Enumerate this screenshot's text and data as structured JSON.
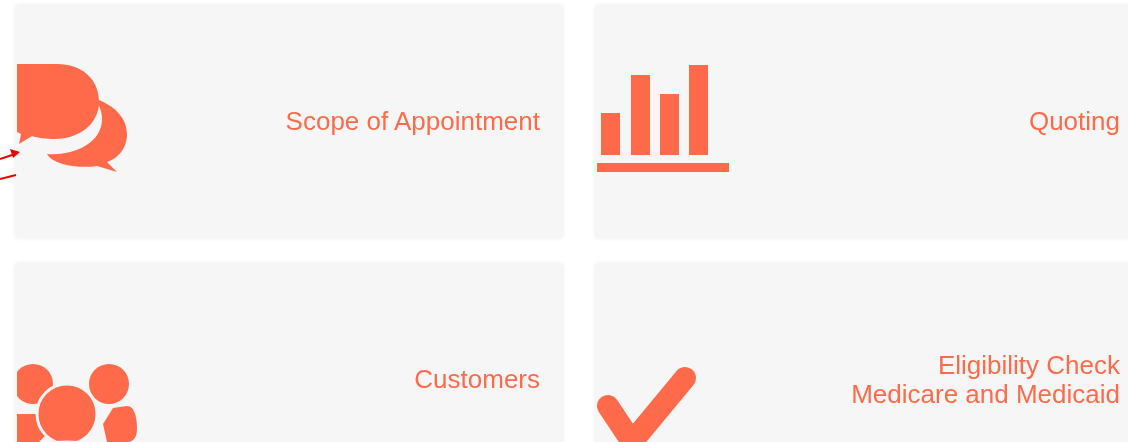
{
  "tiles": [
    {
      "kind": "chat",
      "lines": [
        "Scope of Appointment"
      ]
    },
    {
      "kind": "chart",
      "lines": [
        "Quoting"
      ]
    },
    {
      "kind": "people",
      "lines": [
        "Customers"
      ]
    },
    {
      "kind": "check",
      "lines": [
        "Eligibility Check",
        "Medicare and Medicaid"
      ]
    }
  ]
}
